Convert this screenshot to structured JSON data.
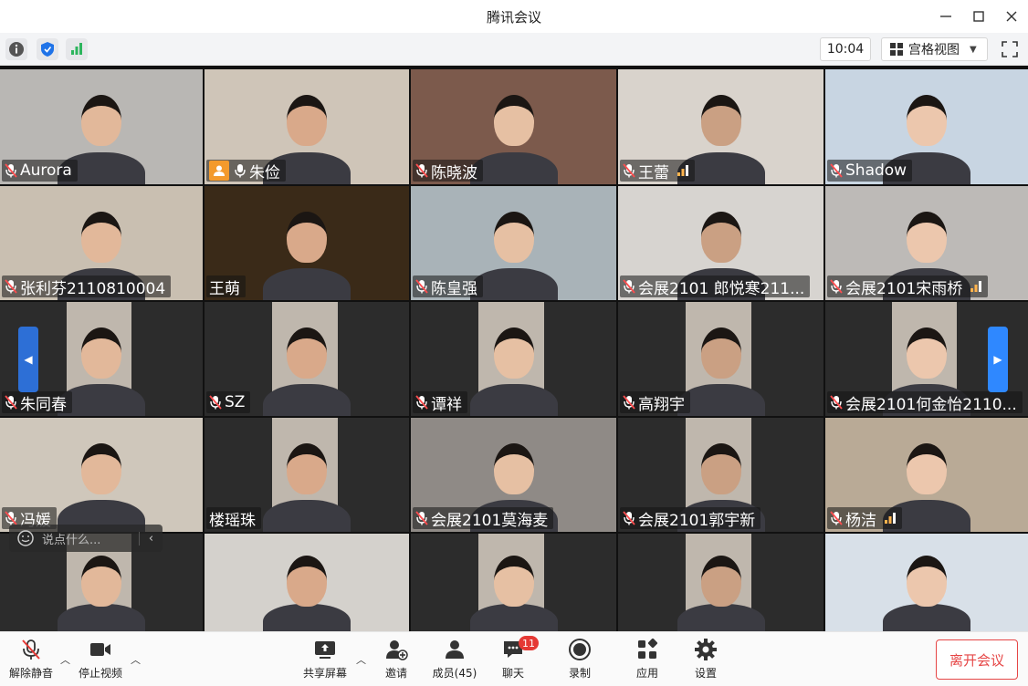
{
  "window": {
    "title": "腾讯会议"
  },
  "statusbar": {
    "time": "10:04",
    "view_mode": "宫格视图",
    "icons": [
      "info-icon",
      "shield-icon",
      "signal-icon",
      "fullscreen-icon"
    ]
  },
  "participants": [
    {
      "name": "Aurora",
      "mic": "muted",
      "bg": "#b9b7b4"
    },
    {
      "name": "朱俭",
      "mic": "on",
      "host": true,
      "active": true,
      "bg": "#cfc5b8"
    },
    {
      "name": "陈晓波",
      "mic": "muted",
      "bg": "#7c5a4c"
    },
    {
      "name": "王蕾",
      "mic": "muted",
      "signal": true,
      "bg": "#d9d3cc"
    },
    {
      "name": "Shadow",
      "mic": "muted",
      "bg": "#c8d5e2"
    },
    {
      "name": "张利芬2110810004",
      "mic": "muted",
      "bg": "#c9bfb1"
    },
    {
      "name": "王萌",
      "mic": "none",
      "bg": "#3a2a18"
    },
    {
      "name": "陈皇强",
      "mic": "muted",
      "bg": "#a9b3b8"
    },
    {
      "name": "会展2101 郎悦寒211...",
      "mic": "muted",
      "bg": "#d7d4d0"
    },
    {
      "name": "会展2101宋雨桥",
      "mic": "muted",
      "signal": true,
      "bg": "#bdbab7"
    },
    {
      "name": "朱同春",
      "mic": "muted",
      "bg": "#2c2c2c"
    },
    {
      "name": "SZ",
      "mic": "muted",
      "bg": "#2c2c2c"
    },
    {
      "name": "谭祥",
      "mic": "muted",
      "bg": "#2c2c2c"
    },
    {
      "name": "高翔宇",
      "mic": "muted",
      "bg": "#2c2c2c"
    },
    {
      "name": "会展2101何金怡2110...",
      "mic": "muted",
      "bg": "#2c2c2c"
    },
    {
      "name": "冯媛",
      "mic": "muted",
      "bg": "#cfc7bb"
    },
    {
      "name": "楼瑶珠",
      "mic": "none",
      "bg": "#2c2c2c"
    },
    {
      "name": "会展2101莫海麦",
      "mic": "muted",
      "bg": "#8f8a86"
    },
    {
      "name": "会展2101郭宇新",
      "mic": "muted",
      "bg": "#2c2c2c"
    },
    {
      "name": "杨洁",
      "mic": "muted",
      "signal": true,
      "bg": "#b9aa96"
    },
    {
      "name": "",
      "mic": "none",
      "bg": "#2c2c2c"
    },
    {
      "name": "",
      "mic": "none",
      "bg": "#d4d1cc"
    },
    {
      "name": "",
      "mic": "none",
      "bg": "#2c2c2c"
    },
    {
      "name": "",
      "mic": "none",
      "bg": "#2c2c2c"
    },
    {
      "name": "",
      "mic": "none",
      "bg": "#d8e0e8"
    }
  ],
  "chat": {
    "placeholder": "说点什么..."
  },
  "toolbar": {
    "unmute": "解除静音",
    "stop_video": "停止视频",
    "share_screen": "共享屏幕",
    "invite": "邀请",
    "members": "成员(45)",
    "chat": "聊天",
    "chat_badge": "11",
    "record": "录制",
    "apps": "应用",
    "settings": "设置",
    "leave": "离开会议"
  },
  "colors": {
    "accent": "#2f88ff",
    "host": "#f39a2c",
    "danger": "#e64646",
    "active": "#34c16e"
  }
}
